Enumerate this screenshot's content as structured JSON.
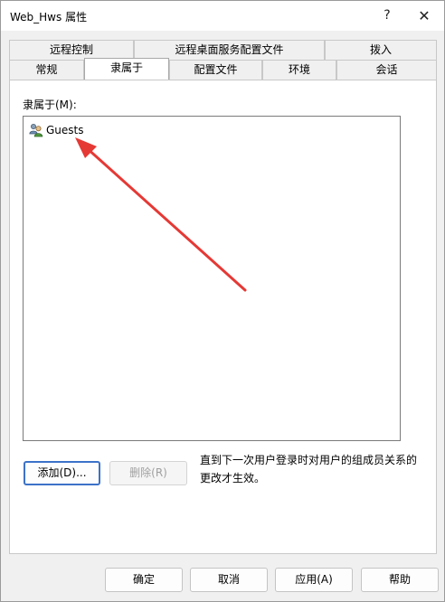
{
  "window": {
    "title": "Web_Hws 属性",
    "help_glyph": "?",
    "close_glyph": "✕"
  },
  "tabs": {
    "row1": [
      "远程控制",
      "远程桌面服务配置文件",
      "拨入"
    ],
    "row2": [
      "常规",
      "隶属于",
      "配置文件",
      "环境",
      "会话"
    ],
    "active": "隶属于"
  },
  "panel": {
    "label": "隶属于(M):",
    "members": [
      {
        "name": "Guests",
        "icon": "group-icon"
      }
    ],
    "add_button": "添加(D)...",
    "remove_button": "删除(R)",
    "note": "直到下一次用户登录时对用户的组成员关系的更改才生效。"
  },
  "footer": {
    "ok": "确定",
    "cancel": "取消",
    "apply": "应用(A)",
    "help": "帮助"
  },
  "colors": {
    "annotation_arrow": "#e53935",
    "focus_border": "#3c72c8"
  }
}
